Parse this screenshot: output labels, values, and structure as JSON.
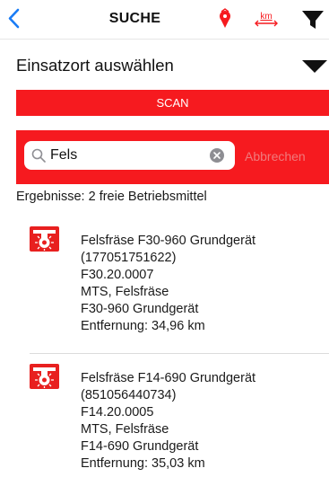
{
  "navbar": {
    "title": "SUCHE",
    "back_icon": "chevron-left-icon",
    "map_icon": "map-pin-icon",
    "distance_label": "km",
    "filter_icon": "funnel-icon",
    "accent_color": "#f61a1f",
    "back_color": "#1a7cf5"
  },
  "location": {
    "label": "Einsatzort auswählen",
    "dropdown_icon": "triangle-down-icon"
  },
  "scan": {
    "label": "SCAN"
  },
  "search": {
    "value": "Fels",
    "icon": "search-icon",
    "clear_icon": "clear-icon",
    "cancel_label": "Abbrechen"
  },
  "results": {
    "summary": "Ergebnisse: 2 freie Betriebsmittel",
    "items": [
      {
        "icon": "milling-machine-icon",
        "title": "Felsfräse F30-960 Grundgerät",
        "id": "(177051751622)",
        "code": "F30.20.0007",
        "category": "MTS, Felsfräse",
        "model": "F30-960 Grundgerät",
        "distance": "Entfernung: 34,96 km"
      },
      {
        "icon": "milling-machine-icon",
        "title": "Felsfräse F14-690 Grundgerät",
        "id": "(851056440734)",
        "code": "F14.20.0005",
        "category": "MTS, Felsfräse",
        "model": "F14-690 Grundgerät",
        "distance": "Entfernung: 35,03 km"
      }
    ]
  }
}
